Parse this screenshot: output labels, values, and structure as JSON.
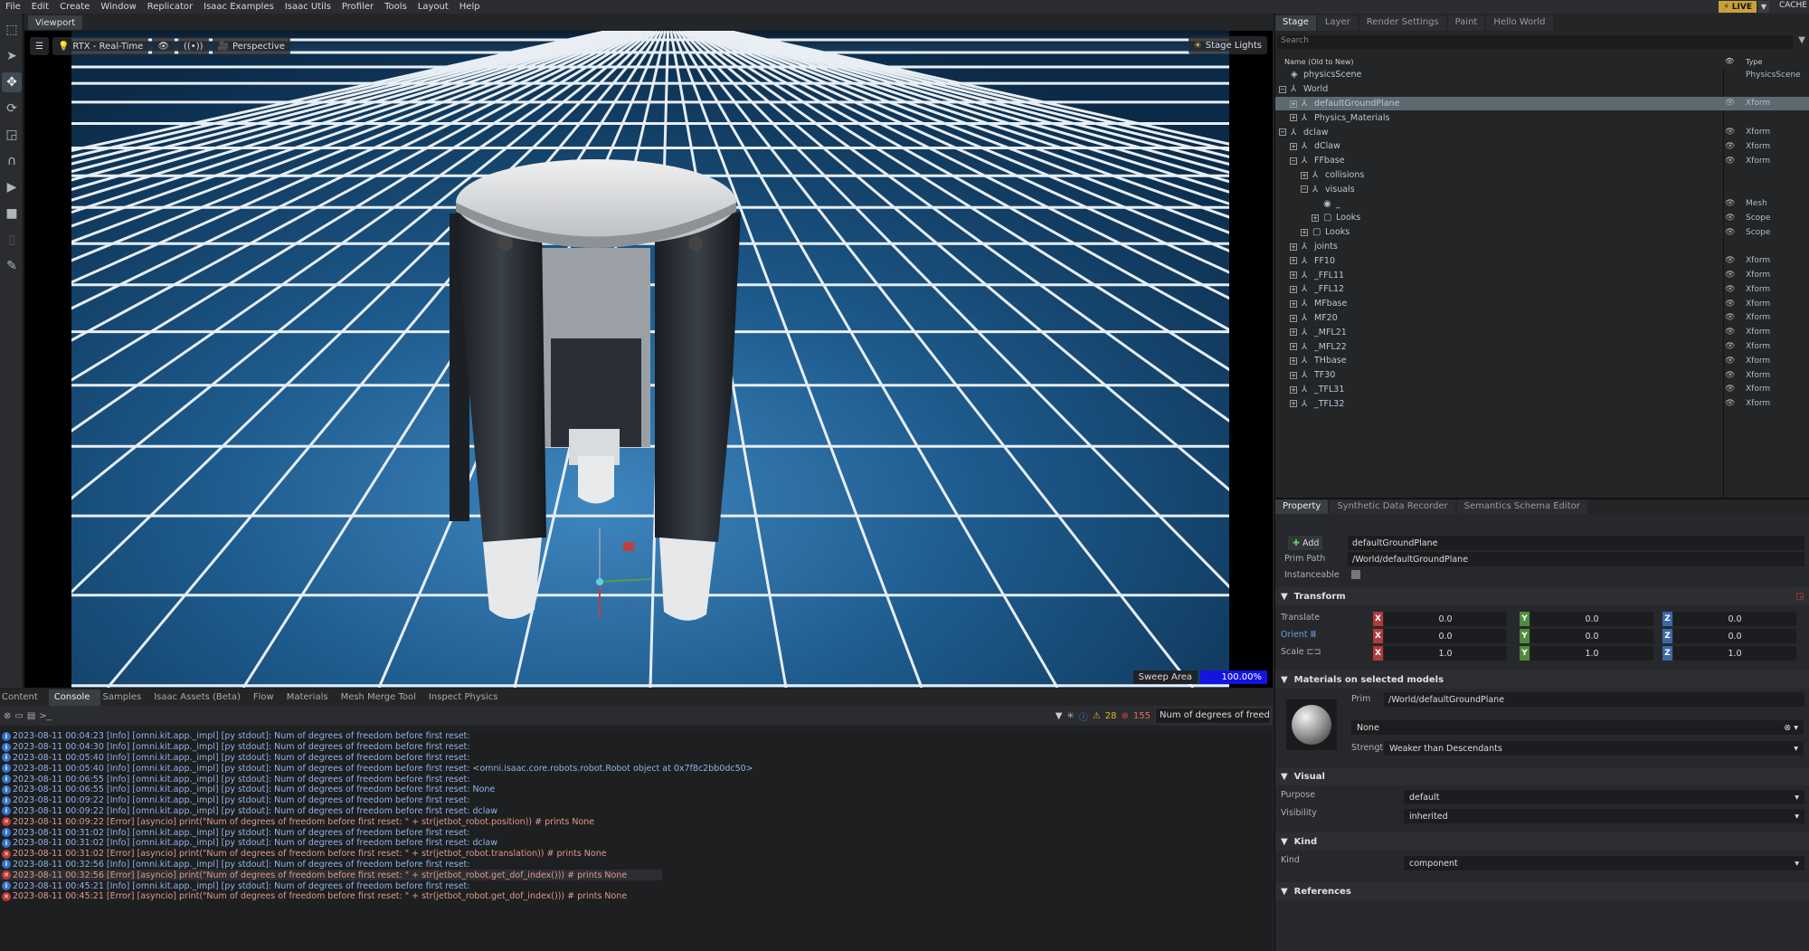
{
  "menu": [
    "File",
    "Edit",
    "Create",
    "Window",
    "Replicator",
    "Isaac Examples",
    "Isaac Utils",
    "Profiler",
    "Tools",
    "Layout",
    "Help"
  ],
  "topright": {
    "live": "LIVE",
    "cache": "CACHE"
  },
  "viewport": {
    "tab": "Viewport",
    "renderer": "RTX - Real-Time",
    "camera": "Perspective",
    "stage_lights": "Stage Lights",
    "sweep_label": "Sweep Area",
    "sweep_value": "100.00%"
  },
  "bottom_tabs": [
    "Content",
    "Console",
    "Samples",
    "Isaac Assets (Beta)",
    "Flow",
    "Materials",
    "Mesh Merge Tool",
    "Inspect Physics"
  ],
  "console": {
    "warn_count": "28",
    "error_count": "155",
    "search_text": "Num of degrees of freedom be",
    "lines": [
      {
        "level": "info",
        "text": "2023-08-11 00:04:23  [Info] [omni.kit.app._impl] [py stdout]: Num of degrees of freedom before first reset:"
      },
      {
        "level": "info",
        "text": "2023-08-11 00:04:30  [Info] [omni.kit.app._impl] [py stdout]: Num of degrees of freedom before first reset:"
      },
      {
        "level": "info",
        "text": "2023-08-11 00:05:40  [Info] [omni.kit.app._impl] [py stdout]: Num of degrees of freedom before first reset:"
      },
      {
        "level": "info",
        "text": "2023-08-11 00:05:40  [Info] [omni.kit.app._impl] [py stdout]: Num of degrees of freedom before first reset: <omni.isaac.core.robots.robot.Robot object at 0x7f8c2bb0dc50>"
      },
      {
        "level": "info",
        "text": "2023-08-11 00:06:55  [Info] [omni.kit.app._impl] [py stdout]: Num of degrees of freedom before first reset:"
      },
      {
        "level": "info",
        "text": "2023-08-11 00:06:55  [Info] [omni.kit.app._impl] [py stdout]: Num of degrees of freedom before first reset: None"
      },
      {
        "level": "info",
        "text": "2023-08-11 00:09:22  [Info] [omni.kit.app._impl] [py stdout]: Num of degrees of freedom before first reset:"
      },
      {
        "level": "info",
        "text": "2023-08-11 00:09:22  [Info] [omni.kit.app._impl] [py stdout]: Num of degrees of freedom before first reset: dclaw"
      },
      {
        "level": "err",
        "text": "2023-08-11 00:09:22  [Error] [asyncio]     print(\"Num of degrees of freedom before first reset: \" + str(jetbot_robot.position)) # prints None"
      },
      {
        "level": "info",
        "text": "2023-08-11 00:31:02  [Info] [omni.kit.app._impl] [py stdout]: Num of degrees of freedom before first reset:"
      },
      {
        "level": "info",
        "text": "2023-08-11 00:31:02  [Info] [omni.kit.app._impl] [py stdout]: Num of degrees of freedom before first reset: dclaw"
      },
      {
        "level": "err",
        "text": "2023-08-11 00:31:02  [Error] [asyncio]     print(\"Num of degrees of freedom before first reset: \" + str(jetbot_robot.translation)) # prints None"
      },
      {
        "level": "info",
        "text": "2023-08-11 00:32:56  [Info] [omni.kit.app._impl] [py stdout]: Num of degrees of freedom before first reset:"
      },
      {
        "level": "err",
        "sel": true,
        "text": "2023-08-11 00:32:56  [Error] [asyncio]     print(\"Num of degrees of freedom before first reset: \" + str(jetbot_robot.get_dof_index())) # prints None"
      },
      {
        "level": "info",
        "text": "2023-08-11 00:45:21  [Info] [omni.kit.app._impl] [py stdout]: Num of degrees of freedom before first reset:"
      },
      {
        "level": "err",
        "text": "2023-08-11 00:45:21  [Error] [asyncio]     print(\"Num of degrees of freedom before first reset: \" + str(jetbot_robot.get_dof_index())) # prints None"
      }
    ]
  },
  "stage": {
    "tabs": [
      "Stage",
      "Layer",
      "Render Settings",
      "Paint",
      "Hello World"
    ],
    "search_placeholder": "Search",
    "header_name": "Name (Old to New)",
    "header_type": "Type",
    "rows": [
      {
        "name": "physicsScene",
        "depth": 0,
        "exp": "",
        "type": "PhysicsScene",
        "eye": false
      },
      {
        "name": "World",
        "depth": 0,
        "exp": "−",
        "type": "",
        "eye": false
      },
      {
        "name": "defaultGroundPlane",
        "depth": 1,
        "exp": "+",
        "type": "Xform",
        "eye": true,
        "sel": true
      },
      {
        "name": "Physics_Materials",
        "depth": 1,
        "exp": "+",
        "type": "",
        "eye": false
      },
      {
        "name": "dclaw",
        "depth": 0,
        "exp": "−",
        "type": "Xform",
        "eye": true
      },
      {
        "name": "dClaw",
        "depth": 1,
        "exp": "+",
        "type": "Xform",
        "eye": true
      },
      {
        "name": "FFbase",
        "depth": 1,
        "exp": "−",
        "type": "Xform",
        "eye": true
      },
      {
        "name": "collisions",
        "depth": 2,
        "exp": "+",
        "type": "",
        "eye": false
      },
      {
        "name": "visuals",
        "depth": 2,
        "exp": "−",
        "type": "",
        "eye": false
      },
      {
        "name": "_",
        "depth": 3,
        "exp": "",
        "type": "Mesh",
        "eye": true
      },
      {
        "name": "Looks",
        "depth": 3,
        "exp": "+",
        "type": "Scope",
        "eye": true
      },
      {
        "name": "Looks",
        "depth": 2,
        "exp": "+",
        "type": "Scope",
        "eye": true
      },
      {
        "name": "joints",
        "depth": 1,
        "exp": "+",
        "type": "",
        "eye": false
      },
      {
        "name": "FF10",
        "depth": 1,
        "exp": "+",
        "type": "Xform",
        "eye": true
      },
      {
        "name": "_FFL11",
        "depth": 1,
        "exp": "+",
        "type": "Xform",
        "eye": true
      },
      {
        "name": "_FFL12",
        "depth": 1,
        "exp": "+",
        "type": "Xform",
        "eye": true
      },
      {
        "name": "MFbase",
        "depth": 1,
        "exp": "+",
        "type": "Xform",
        "eye": true
      },
      {
        "name": "MF20",
        "depth": 1,
        "exp": "+",
        "type": "Xform",
        "eye": true
      },
      {
        "name": "_MFL21",
        "depth": 1,
        "exp": "+",
        "type": "Xform",
        "eye": true
      },
      {
        "name": "_MFL22",
        "depth": 1,
        "exp": "+",
        "type": "Xform",
        "eye": true
      },
      {
        "name": "THbase",
        "depth": 1,
        "exp": "+",
        "type": "Xform",
        "eye": true
      },
      {
        "name": "TF30",
        "depth": 1,
        "exp": "+",
        "type": "Xform",
        "eye": true
      },
      {
        "name": "_TFL31",
        "depth": 1,
        "exp": "+",
        "type": "Xform",
        "eye": true
      },
      {
        "name": "_TFL32",
        "depth": 1,
        "exp": "+",
        "type": "Xform",
        "eye": true
      }
    ]
  },
  "property": {
    "tabs": [
      "Property",
      "Synthetic Data Recorder",
      "Semantics Schema Editor"
    ],
    "add_label": "Add",
    "prim_name": "defaultGroundPlane",
    "prim_path_label": "Prim Path",
    "prim_path": "/World/defaultGroundPlane",
    "instanceable_label": "Instanceable",
    "transform_title": "Transform",
    "translate_label": "Translate",
    "orient_label": "Orient",
    "scale_label": "Scale",
    "translate": [
      "0.0",
      "0.0",
      "0.0"
    ],
    "orient": [
      "0.0",
      "0.0",
      "0.0"
    ],
    "scale": [
      "1.0",
      "1.0",
      "1.0"
    ],
    "materials_title": "Materials on selected models",
    "mat_prim_label": "Prim",
    "mat_prim": "/World/defaultGroundPlane",
    "mat_value": "None",
    "strength_label": "Strength",
    "strength": "Weaker than Descendants",
    "visual_title": "Visual",
    "purpose_label": "Purpose",
    "purpose": "default",
    "visibility_label": "Visibility",
    "visibility": "inherited",
    "kind_title": "Kind",
    "kind_label": "Kind",
    "kind": "component",
    "references_title": "References"
  }
}
